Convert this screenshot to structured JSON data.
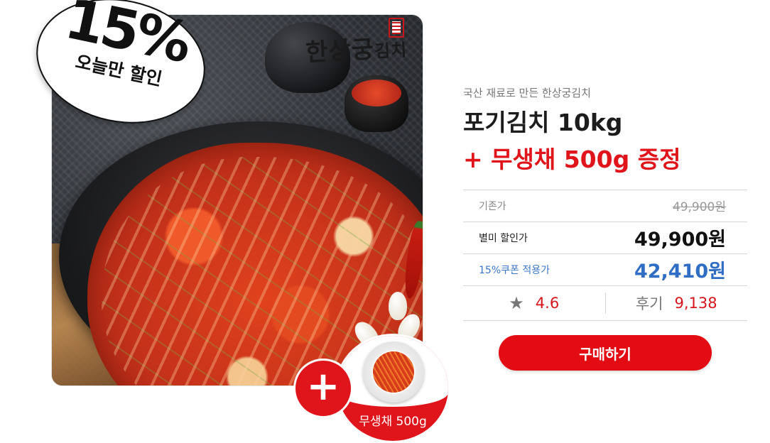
{
  "badge": {
    "percent": "15%",
    "text": "오늘만 할인"
  },
  "logo": {
    "main": "한상궁",
    "suffix": "김치"
  },
  "bonus": {
    "plus": "+",
    "label": "무생채 500g"
  },
  "product": {
    "subtitle": "국산 재료로 만든 한상궁김치",
    "title_line1": "포기김치 10kg",
    "title_line2": "+ 무생채 500g 증정"
  },
  "prices": {
    "original_label": "기존가",
    "original_value": "49,900원",
    "sale_label": "별미 할인가",
    "sale_value": "49,900원",
    "coupon_label": "15%쿠폰 적용가",
    "coupon_value": "42,410원"
  },
  "stats": {
    "star": "★",
    "rating": "4.6",
    "review_label": "후기",
    "review_count": "9,138"
  },
  "buy_button": "구매하기",
  "colors": {
    "accent": "#e0141b",
    "coupon": "#2f6ec4"
  }
}
